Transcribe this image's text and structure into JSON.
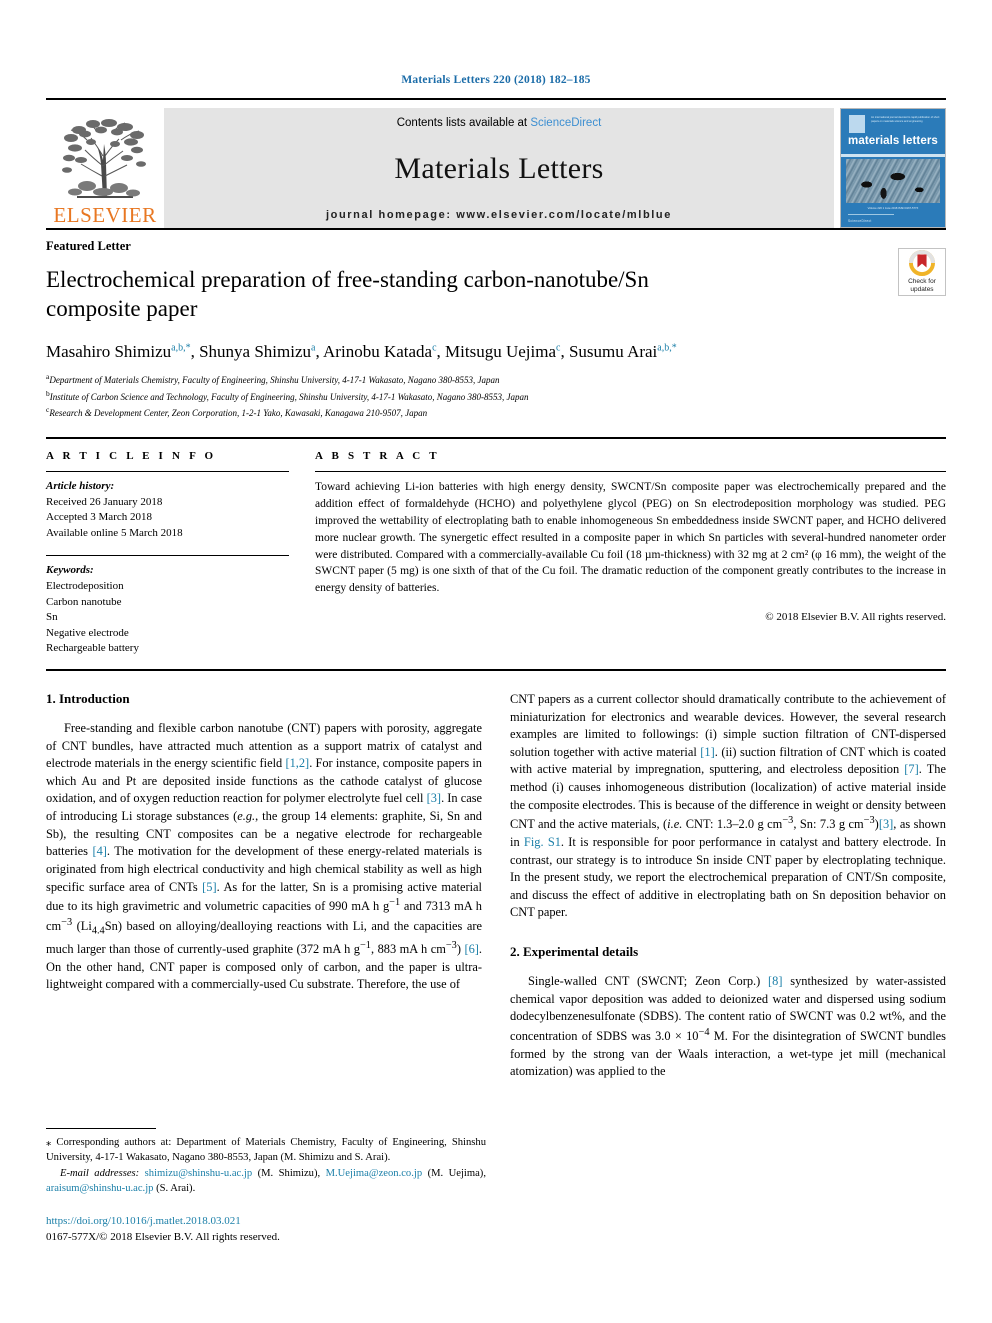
{
  "running_head": "Materials Letters 220 (2018) 182–185",
  "masthead": {
    "publisher": "ELSEVIER",
    "contents_prefix": "Contents lists available at ",
    "contents_link": "ScienceDirect",
    "journal_title": "Materials Letters",
    "homepage": "journal homepage: www.elsevier.com/locate/mlblue",
    "cover": {
      "title": "materials letters",
      "subhead": "An international journal devoted to rapid publication of short papers on materials science and engineering",
      "caption": "Volume 220  1 June 2018  ISSN 0167-577X",
      "foot": "ScienceDirect"
    }
  },
  "article": {
    "type": "Featured Letter",
    "title": "Electrochemical preparation of free-standing carbon-nanotube/Sn composite paper",
    "crossmark_label": "Check for\nupdates",
    "authors": [
      {
        "name": "Masahiro Shimizu",
        "sup": "a,b,*"
      },
      {
        "name": "Shunya Shimizu",
        "sup": "a"
      },
      {
        "name": "Arinobu Katada",
        "sup": "c"
      },
      {
        "name": "Mitsugu Uejima",
        "sup": "c"
      },
      {
        "name": "Susumu Arai",
        "sup": "a,b,*"
      }
    ],
    "affiliations": [
      {
        "mark": "a",
        "text": "Department of Materials Chemistry, Faculty of Engineering, Shinshu University, 4-17-1 Wakasato, Nagano 380-8553, Japan"
      },
      {
        "mark": "b",
        "text": "Institute of Carbon Science and Technology, Faculty of Engineering, Shinshu University, 4-17-1 Wakasato, Nagano 380-8553, Japan"
      },
      {
        "mark": "c",
        "text": "Research & Development Center, Zeon Corporation, 1-2-1 Yako, Kawasaki, Kanagawa 210-9507, Japan"
      }
    ]
  },
  "article_info": {
    "heading": "A R T I C L E   I N F O",
    "history_label": "Article history:",
    "history": [
      "Received 26 January 2018",
      "Accepted 3 March 2018",
      "Available online 5 March 2018"
    ],
    "keywords_label": "Keywords:",
    "keywords": [
      "Electrodeposition",
      "Carbon nanotube",
      "Sn",
      "Negative electrode",
      "Rechargeable battery"
    ]
  },
  "abstract": {
    "heading": "A B S T R A C T",
    "text": "Toward achieving Li-ion batteries with high energy density, SWCNT/Sn composite paper was electrochemically prepared and the addition effect of formaldehyde (HCHO) and polyethylene glycol (PEG) on Sn electrodeposition morphology was studied. PEG improved the wettability of electroplating bath to enable inhomogeneous Sn embeddedness inside SWCNT paper, and HCHO delivered more nuclear growth. The synergetic effect resulted in a composite paper in which Sn particles with several-hundred nanometer order were distributed. Compared with a commercially-available Cu foil (18 µm-thickness) with 32 mg at 2 cm² (φ 16 mm), the weight of the SWCNT paper (5 mg) is one sixth of that of the Cu foil. The dramatic reduction of the component greatly contributes to the increase in energy density of batteries.",
    "copyright": "© 2018 Elsevier B.V. All rights reserved."
  },
  "sections": {
    "intro_heading": "1. Introduction",
    "experimental_heading": "2. Experimental details"
  },
  "footnotes": {
    "corresponding_mark": "⁎",
    "corresponding": " Corresponding authors at: Department of Materials Chemistry, Faculty of Engineering, Shinshu University, 4-17-1 Wakasato, Nagano 380-8553, Japan (M. Shimizu and S. Arai).",
    "email_label": "E-mail addresses:",
    "emails": [
      {
        "addr": "shimizu@shinshu-u.ac.jp",
        "who": " (M. Shimizu), "
      },
      {
        "addr": "M.Uejima@zeon.co.jp",
        "who": " (M. Uejima), "
      },
      {
        "addr": "araisum@shinshu-u.ac.jp",
        "who": " (S. Arai)."
      }
    ],
    "doi": "https://doi.org/10.1016/j.matlet.2018.03.021",
    "issn_line": "0167-577X/© 2018 Elsevier B.V. All rights reserved."
  },
  "colors": {
    "link": "#1b7fa8",
    "running_head": "#1b6ca8",
    "elsevier_orange": "#e87722",
    "cover_blue": "#2b7bb9",
    "band_gray": "#e4e4e4"
  }
}
